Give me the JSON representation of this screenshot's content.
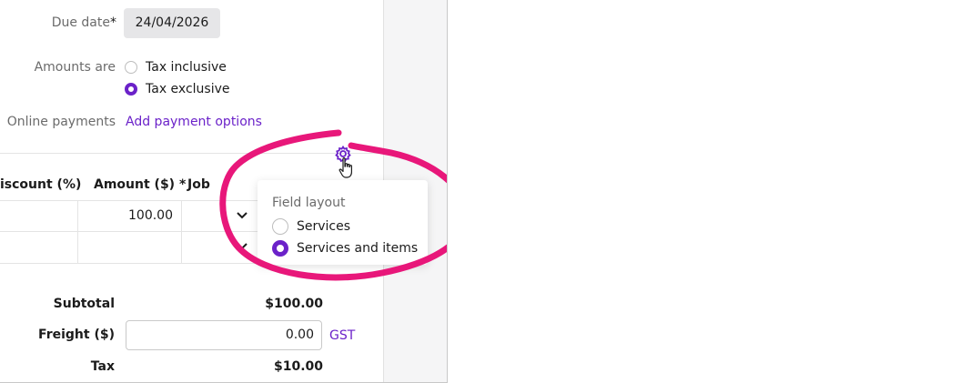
{
  "form": {
    "due_date_label": "Due date",
    "due_date_required": "*",
    "due_date_value": "24/04/2026",
    "amounts_label": "Amounts are",
    "amounts_options": [
      {
        "label": "Tax inclusive",
        "selected": false
      },
      {
        "label": "Tax exclusive",
        "selected": true
      }
    ],
    "online_payments_label": "Online payments",
    "online_payments_link": "Add payment options"
  },
  "table": {
    "columns": [
      "iscount (%)",
      "Amount ($) *",
      "Job"
    ],
    "rows": [
      {
        "amount": "100.00"
      },
      {
        "amount": ""
      }
    ]
  },
  "settings": {
    "icon": "gear-icon",
    "cursor": "hand-pointer-icon"
  },
  "popover": {
    "title": "Field layout",
    "options": [
      {
        "label": "Services",
        "selected": false
      },
      {
        "label": "Services and items",
        "selected": true
      }
    ]
  },
  "totals": {
    "subtotal_label": "Subtotal",
    "subtotal_value": "$100.00",
    "freight_label": "Freight ($)",
    "freight_value": "0.00",
    "freight_tax_code": "GST",
    "tax_label": "Tax",
    "tax_value": "$10.00"
  },
  "colors": {
    "accent": "#6b22c9",
    "highlight_ring": "#e8177a"
  }
}
